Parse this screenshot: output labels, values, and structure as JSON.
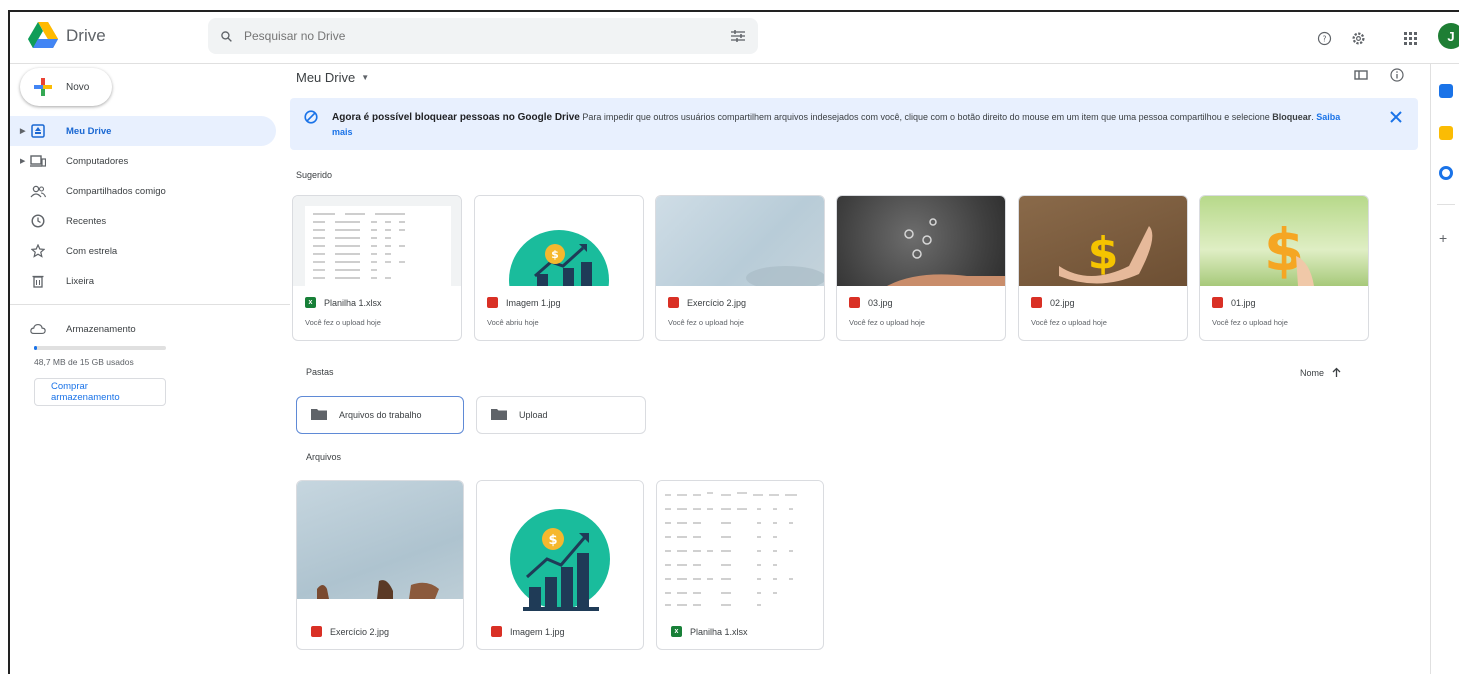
{
  "header": {
    "app_name": "Drive",
    "search_placeholder": "Pesquisar no Drive"
  },
  "sidebar": {
    "new_label": "Novo",
    "items": [
      {
        "label": "Meu Drive",
        "icon": "my-drive-icon",
        "active": true,
        "expandable": true
      },
      {
        "label": "Computadores",
        "icon": "computer-icon",
        "active": false,
        "expandable": true
      },
      {
        "label": "Compartilhados comigo",
        "icon": "shared-icon",
        "active": false,
        "expandable": false
      },
      {
        "label": "Recentes",
        "icon": "clock-icon",
        "active": false,
        "expandable": false
      },
      {
        "label": "Com estrela",
        "icon": "star-icon",
        "active": false,
        "expandable": false
      },
      {
        "label": "Lixeira",
        "icon": "trash-icon",
        "active": false,
        "expandable": false
      }
    ],
    "storage_label": "Armazenamento",
    "storage_usage": "48,7 MB de 15 GB usados",
    "storage_fraction": 0.003,
    "buy_line1": "Comprar",
    "buy_line2": "armazenamento"
  },
  "main": {
    "title": "Meu Drive",
    "banner": {
      "headline": "Agora é possível bloquear pessoas no Google Drive",
      "body1": "Para impedir que outros usuários compartilhem arquivos indesejados com você, clique com o botão direito do mouse em um item que uma pessoa compartilhou e selecione",
      "bold_word": "Bloquear",
      "link": "Saiba mais"
    },
    "suggested_label": "Sugerido",
    "suggested": [
      {
        "name": "Planilha 1.xlsx",
        "type": "xls",
        "sub": "Você fez o upload hoje"
      },
      {
        "name": "Imagem 1.jpg",
        "type": "img",
        "sub": "Você abriu hoje"
      },
      {
        "name": "Exercício 2.jpg",
        "type": "img",
        "sub": "Você fez o upload hoje"
      },
      {
        "name": "03.jpg",
        "type": "img",
        "sub": "Você fez o upload hoje"
      },
      {
        "name": "02.jpg",
        "type": "img",
        "sub": "Você fez o upload hoje"
      },
      {
        "name": "01.jpg",
        "type": "img",
        "sub": "Você fez o upload hoje"
      }
    ],
    "folders_label": "Pastas",
    "sort_label": "Nome",
    "folders": [
      {
        "name": "Arquivos do trabalho",
        "selected": true
      },
      {
        "name": "Upload",
        "selected": false
      }
    ],
    "files_label": "Arquivos",
    "files": [
      {
        "name": "Exercício 2.jpg",
        "type": "img"
      },
      {
        "name": "Imagem 1.jpg",
        "type": "img"
      },
      {
        "name": "Planilha 1.xlsx",
        "type": "xls"
      }
    ]
  },
  "colors": {
    "accent": "#1a73e8",
    "active_bg": "#e8f0fe",
    "avatar": "#1e7e34",
    "image_file": "#d93025",
    "sheet_file": "#188038",
    "teal": "#1abc9c"
  },
  "avatar_initial": "J"
}
